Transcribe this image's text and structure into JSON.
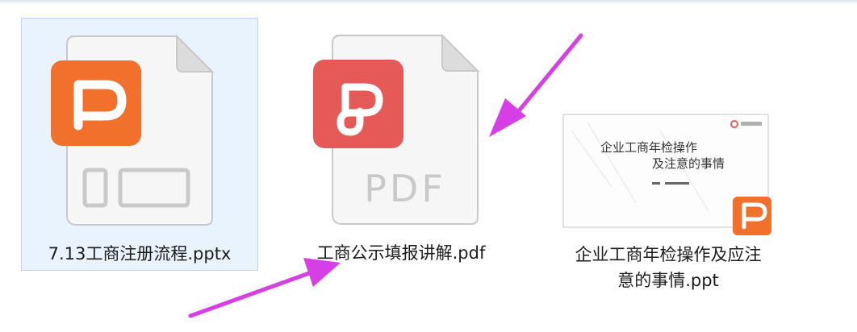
{
  "files": [
    {
      "name": "7.13工商注册流程.pptx",
      "type": "pptx",
      "icon": "powerpoint-file-icon",
      "selected": true
    },
    {
      "name": "工商公示填报讲解.pdf",
      "type": "pdf",
      "icon": "pdf-file-icon",
      "badge_text": "PDF",
      "selected": false
    },
    {
      "name_line1": "企业工商年检操作及应注",
      "name_line2": "意的事情.ppt",
      "type": "ppt",
      "icon": "slide-thumbnail-icon",
      "thumbnail": {
        "title_line1": "企业工商年检操作",
        "title_line2": "及注意的事情"
      },
      "selected": false
    }
  ],
  "colors": {
    "ppt_orange": "#f0702c",
    "pdf_red": "#e55a57",
    "arrow_magenta": "#d63ee6",
    "selection_bg": "#e9f3fd",
    "selection_border": "#b7d4f0"
  }
}
